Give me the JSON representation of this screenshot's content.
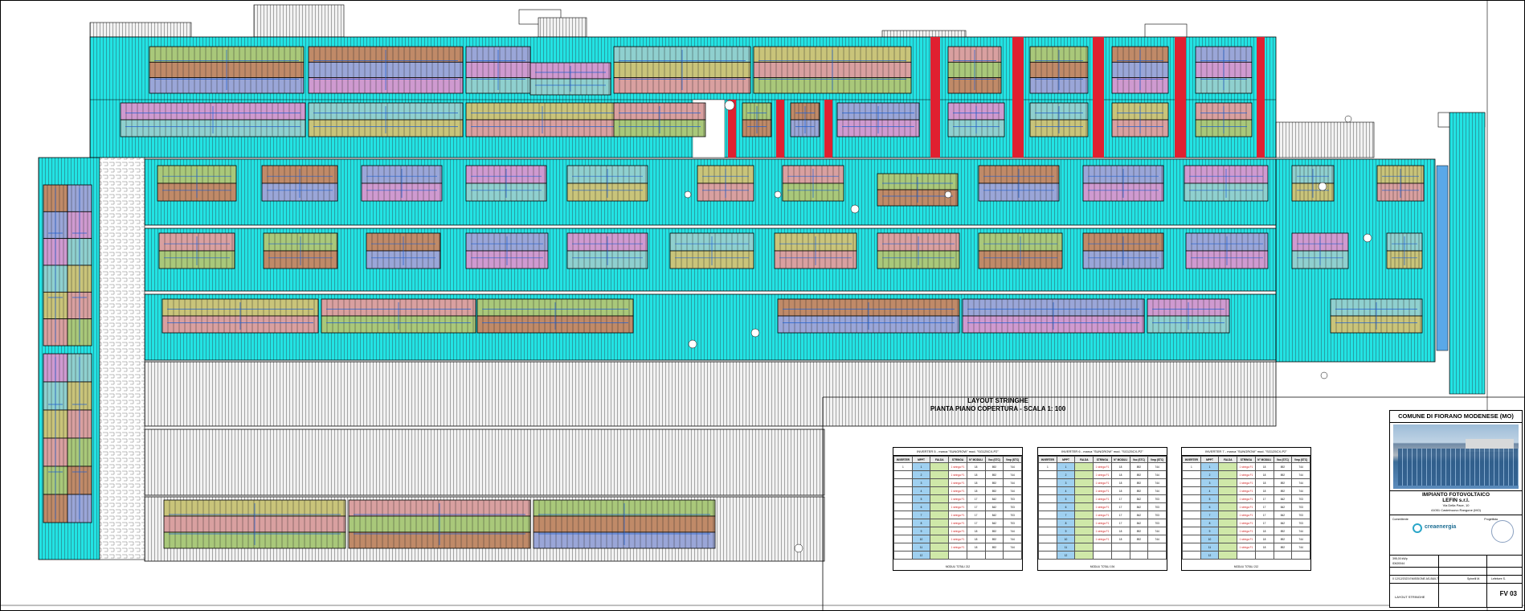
{
  "drawing": {
    "title_line1": "LAYOUT STRINGHE",
    "title_line2": "PIANTA PIANO COPERTURA - SCALA 1: 100",
    "colors": {
      "roof_cyan": "#1ee0e0",
      "roof_grey": "#e8e8e8",
      "red_divider": "#e02030",
      "stringer_blue": "#2060d0",
      "module_palette": [
        "#a9c87a",
        "#c08a68",
        "#9aa6d8",
        "#cf9ad0",
        "#8fd0cf",
        "#c9c47a",
        "#d9a0a0"
      ]
    }
  },
  "inverter_tables": [
    {
      "caption": "INVERTER 5 - marca \"SUNGROW\" mod. \"SG125CX-P2\"",
      "headers": [
        "INVERTER",
        "MPPT",
        "FALDA",
        "STRINGA",
        "N° MODULI",
        "Voc (STC)",
        "Vmp (STC)"
      ],
      "rows": [
        [
          "1",
          "1",
          "",
          "1 stringa F1",
          "18",
          "892",
          "744"
        ],
        [
          "",
          "2",
          "",
          "1 stringa F1",
          "18",
          "892",
          "744"
        ],
        [
          "",
          "3",
          "",
          "1 stringa F1",
          "18",
          "892",
          "744"
        ],
        [
          "",
          "4",
          "",
          "1 stringa F1",
          "18",
          "892",
          "744"
        ],
        [
          "",
          "5",
          "",
          "1 stringa F1",
          "17",
          "842",
          "703"
        ],
        [
          "",
          "6",
          "",
          "1 stringa F1",
          "17",
          "842",
          "703"
        ],
        [
          "",
          "7",
          "",
          "1 stringa F1",
          "17",
          "842",
          "703"
        ],
        [
          "",
          "8",
          "",
          "1 stringa F1",
          "17",
          "842",
          "703"
        ],
        [
          "",
          "9",
          "",
          "1 stringa F1",
          "18",
          "892",
          "744"
        ],
        [
          "",
          "10",
          "",
          "1 stringa F1",
          "18",
          "892",
          "744"
        ],
        [
          "",
          "11",
          "",
          "1 stringa F1",
          "18",
          "892",
          "744"
        ],
        [
          "",
          "12",
          "",
          "",
          "",
          "",
          ""
        ]
      ],
      "footer": "MODULI TOTALI           212"
    },
    {
      "caption": "INVERTER 6 - marca \"SUNGROW\" mod. \"SG125CX-P2\"",
      "headers": [
        "INVERTER",
        "MPPT",
        "FALDA",
        "STRINGA",
        "N° MODULI",
        "Voc (STC)",
        "Vmp (STC)"
      ],
      "rows": [
        [
          "1",
          "1",
          "",
          "1 stringa F1",
          "18",
          "892",
          "744"
        ],
        [
          "",
          "2",
          "",
          "1 stringa F1",
          "18",
          "892",
          "744"
        ],
        [
          "",
          "3",
          "",
          "1 stringa F1",
          "18",
          "892",
          "744"
        ],
        [
          "",
          "4",
          "",
          "1 stringa F1",
          "18",
          "892",
          "744"
        ],
        [
          "",
          "5",
          "",
          "1 stringa F1",
          "17",
          "842",
          "703"
        ],
        [
          "",
          "6",
          "",
          "1 stringa F1",
          "17",
          "842",
          "703"
        ],
        [
          "",
          "7",
          "",
          "1 stringa F1",
          "17",
          "842",
          "703"
        ],
        [
          "",
          "8",
          "",
          "1 stringa F1",
          "17",
          "842",
          "703"
        ],
        [
          "",
          "9",
          "",
          "1 stringa F1",
          "18",
          "892",
          "744"
        ],
        [
          "",
          "10",
          "",
          "1 stringa F1",
          "18",
          "892",
          "744"
        ],
        [
          "",
          "11",
          "",
          "",
          "",
          "",
          ""
        ],
        [
          "",
          "12",
          "",
          "",
          "",
          "",
          ""
        ]
      ],
      "footer": "MODULI TOTALI           194"
    },
    {
      "caption": "INVERTER 7 - marca \"SUNGROW\" mod. \"SG125CX-P2\"",
      "headers": [
        "INVERTER",
        "MPPT",
        "FALDA",
        "STRINGA",
        "N° MODULI",
        "Voc (STC)",
        "Vmp (STC)"
      ],
      "rows": [
        [
          "1",
          "1",
          "",
          "1 stringa F1",
          "18",
          "892",
          "744"
        ],
        [
          "",
          "2",
          "",
          "1 stringa F1",
          "18",
          "892",
          "744"
        ],
        [
          "",
          "3",
          "",
          "1 stringa F1",
          "18",
          "892",
          "744"
        ],
        [
          "",
          "4",
          "",
          "1 stringa F1",
          "18",
          "892",
          "744"
        ],
        [
          "",
          "5",
          "",
          "1 stringa F1",
          "17",
          "842",
          "703"
        ],
        [
          "",
          "6",
          "",
          "1 stringa F1",
          "17",
          "842",
          "703"
        ],
        [
          "",
          "7",
          "",
          "1 stringa F1",
          "17",
          "842",
          "703"
        ],
        [
          "",
          "8",
          "",
          "1 stringa F1",
          "17",
          "842",
          "703"
        ],
        [
          "",
          "9",
          "",
          "1 stringa F1",
          "18",
          "892",
          "744"
        ],
        [
          "",
          "10",
          "",
          "1 stringa F1",
          "18",
          "892",
          "744"
        ],
        [
          "",
          "11",
          "",
          "1 stringa F1",
          "18",
          "892",
          "744"
        ],
        [
          "",
          "12",
          "",
          "",
          "",
          "",
          ""
        ]
      ],
      "footer": "MODULI TOTALI           212"
    }
  ],
  "cartouche": {
    "municipality": "COMUNE DI FIORANO MODENESE (MO)",
    "project": "IMPIANTO FOTOVOLTAICO",
    "client": "LEFIN s.r.l.",
    "address": "Via Della Pace, 10",
    "city": "41051 Castelnuovo Rangone (MO)",
    "designer_label": "Committente",
    "logo_text": "creaenergia",
    "power_label": "Potenza impianto",
    "power_value": "395,00 kWp",
    "scale_label": "Scala",
    "scale_value": "1:100",
    "date_value": "7/2/ No",
    "job_code": "ID620044",
    "rev_row": "0     12/12/2023     EMISSIONE AS-BUILT",
    "rev_author": "Spinelli M.",
    "rev_checker": "Lefebvre S.",
    "sheet_title": "LAYOUT STRINGHE",
    "sheet_code": "FV 03",
    "progettista_label": "Progettista"
  }
}
